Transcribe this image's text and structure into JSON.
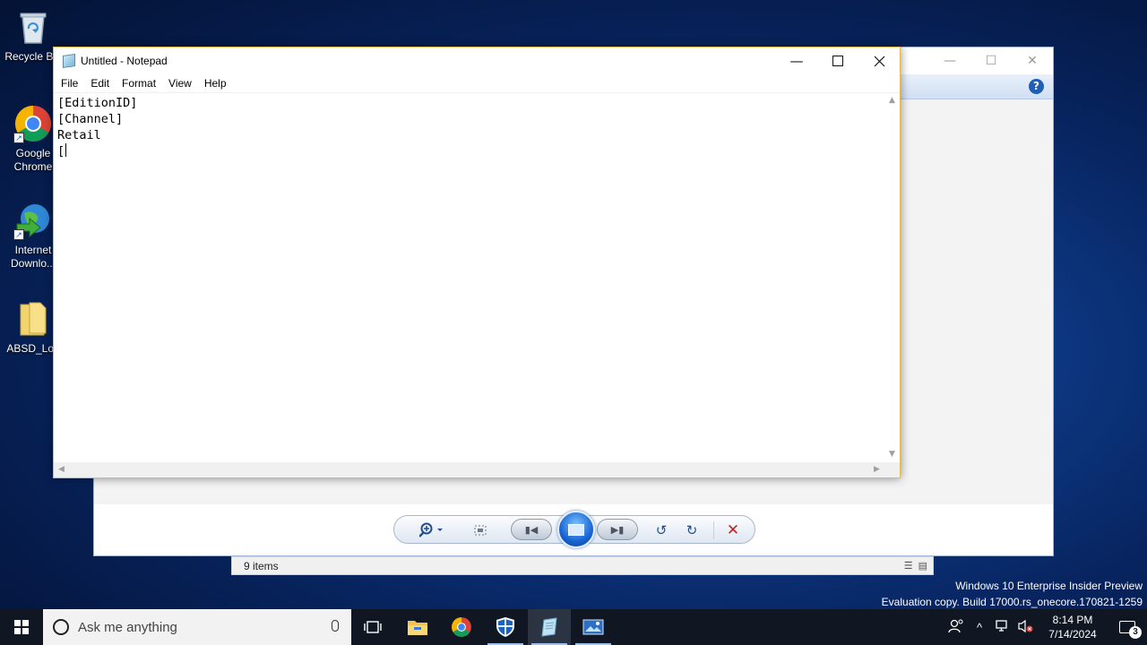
{
  "desktop": {
    "icons": [
      {
        "label": "Recycle Bin"
      },
      {
        "label": "Google Chrome"
      },
      {
        "label": "Internet Downlo..."
      },
      {
        "label": "ABSD_Log"
      }
    ]
  },
  "photo_viewer": {
    "help_label": "?"
  },
  "explorer": {
    "status_count": "9 items"
  },
  "notepad": {
    "title": "Untitled - Notepad",
    "menu": [
      "File",
      "Edit",
      "Format",
      "View",
      "Help"
    ],
    "lines": [
      "[EditionID]",
      "[Channel]",
      "Retail",
      "["
    ]
  },
  "watermark": {
    "line1": "Windows 10 Enterprise Insider Preview",
    "line2": "Evaluation copy. Build 17000.rs_onecore.170821-1259"
  },
  "taskbar": {
    "search_placeholder": "Ask me anything",
    "time": "8:14 PM",
    "date": "7/14/2024",
    "notification_count": "3"
  },
  "colors": {
    "notepad_border": "#e7b84a",
    "taskbar": "#101722",
    "desktop_blue": "#0d3a86"
  }
}
